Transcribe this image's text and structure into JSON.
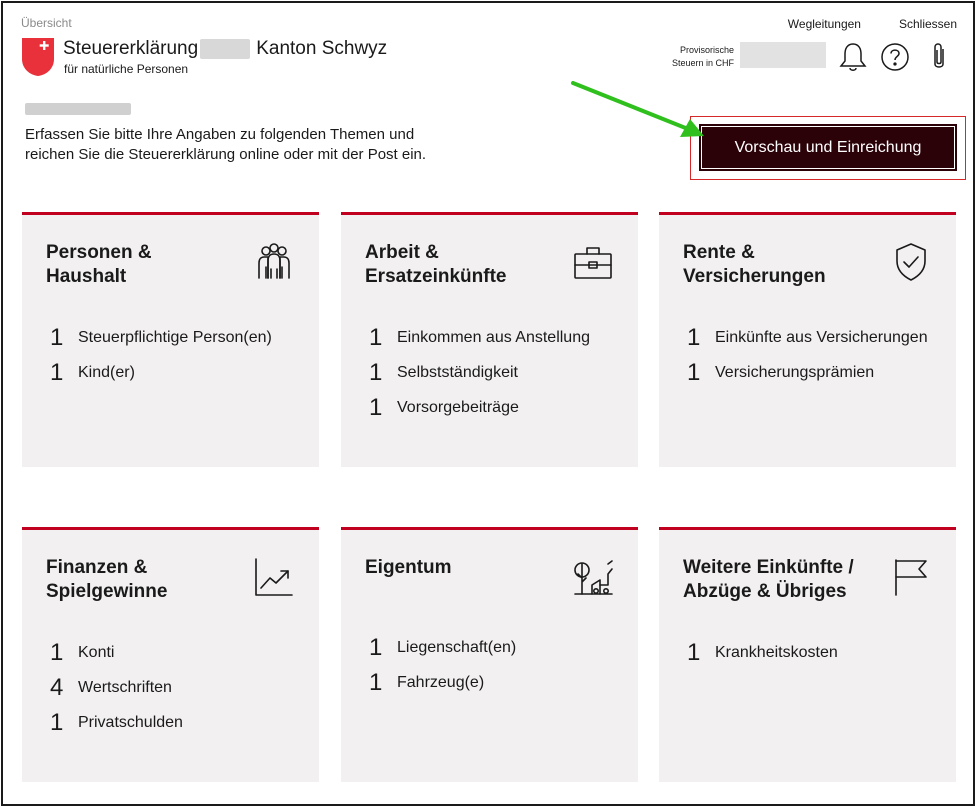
{
  "header": {
    "overview_link": "Übersicht",
    "title_part1": "Steuererklärung",
    "title_part2": "Kanton Schwyz",
    "subtitle": "für natürliche Personen",
    "guides_link": "Wegleitungen",
    "close_link": "Schliessen",
    "tax_label_line1": "Provisorische",
    "tax_label_line2": "Steuern in CHF"
  },
  "intro": {
    "text_line1": "Erfassen Sie bitte Ihre Angaben zu folgenden Themen und",
    "text_line2": "reichen Sie die Steuererklärung online oder mit der Post ein."
  },
  "actions": {
    "submit_label": "Vorschau und Einreichung"
  },
  "colors": {
    "accent": "#c0001e",
    "button_bg": "#2b0208",
    "card_bg": "#f2f0f1",
    "arrow": "#2fc01d"
  },
  "cards": [
    {
      "title_line1": "Personen &",
      "title_line2": "Haushalt",
      "icon": "people-icon",
      "items": [
        {
          "count": "1",
          "label": "Steuerpflichtige Person(en)"
        },
        {
          "count": "1",
          "label": "Kind(er)"
        }
      ]
    },
    {
      "title_line1": "Arbeit &",
      "title_line2": "Ersatzeinkünfte",
      "icon": "briefcase-icon",
      "items": [
        {
          "count": "1",
          "label": "Einkommen aus Anstellung"
        },
        {
          "count": "1",
          "label": "Selbstständigkeit"
        },
        {
          "count": "1",
          "label": "Vorsorgebeiträge"
        }
      ]
    },
    {
      "title_line1": "Rente &",
      "title_line2": "Versicherungen",
      "icon": "shield-check-icon",
      "items": [
        {
          "count": "1",
          "label": "Einkünfte aus Versicherungen"
        },
        {
          "count": "1",
          "label": "Versicherungsprämien"
        }
      ]
    },
    {
      "title_line1": "Finanzen &",
      "title_line2": "Spielgewinne",
      "icon": "chart-up-icon",
      "items": [
        {
          "count": "1",
          "label": "Konti"
        },
        {
          "count": "4",
          "label": "Wertschriften"
        },
        {
          "count": "1",
          "label": "Privatschulden"
        }
      ]
    },
    {
      "title_line1": "Eigentum",
      "title_line2": "",
      "icon": "property-icon",
      "items": [
        {
          "count": "1",
          "label": "Liegenschaft(en)"
        },
        {
          "count": "1",
          "label": "Fahrzeug(e)"
        }
      ]
    },
    {
      "title_line1": "Weitere Einkünfte /",
      "title_line2": "Abzüge & Übriges",
      "icon": "flag-icon",
      "items": [
        {
          "count": "1",
          "label": "Krankheitskosten"
        }
      ]
    }
  ]
}
